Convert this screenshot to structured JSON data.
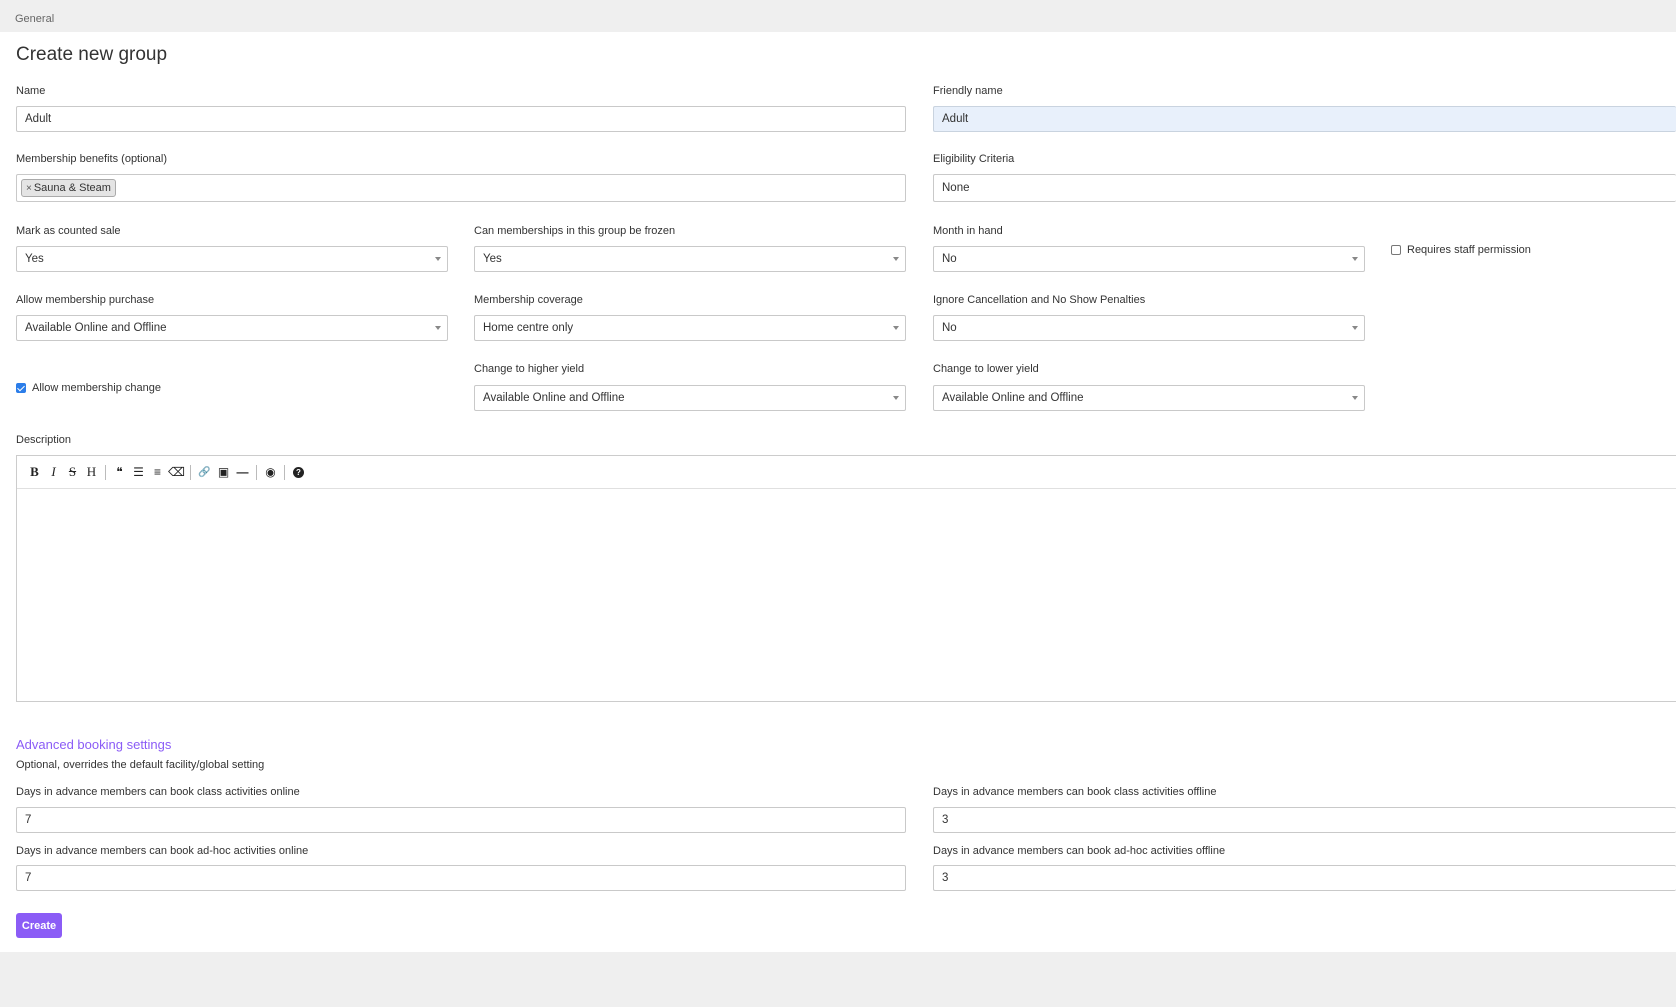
{
  "breadcrumb": "General",
  "page_title": "Create new group",
  "fields": {
    "name": {
      "label": "Name",
      "value": "Adult"
    },
    "friendly_name": {
      "label": "Friendly name",
      "value": "Adult"
    },
    "benefits": {
      "label": "Membership benefits (optional)",
      "tags": [
        "Sauna & Steam"
      ],
      "tag_remove": "×"
    },
    "eligibility": {
      "label": "Eligibility Criteria",
      "value": "None"
    },
    "counted_sale": {
      "label": "Mark as counted sale",
      "value": "Yes"
    },
    "frozen": {
      "label": "Can memberships in this group be frozen",
      "value": "Yes"
    },
    "month_in_hand": {
      "label": "Month in hand",
      "value": "No"
    },
    "staff_permission": {
      "label": "Requires staff permission",
      "checked": false
    },
    "allow_purchase": {
      "label": "Allow membership purchase",
      "value": "Available Online and Offline"
    },
    "coverage": {
      "label": "Membership coverage",
      "value": "Home centre only"
    },
    "ignore_penalties": {
      "label": "Ignore Cancellation and No Show Penalties",
      "value": "No"
    },
    "allow_change": {
      "label": "Allow membership change",
      "checked": true
    },
    "higher_yield": {
      "label": "Change to higher yield",
      "value": "Available Online and Offline"
    },
    "lower_yield": {
      "label": "Change to lower yield",
      "value": "Available Online and Offline"
    },
    "description": {
      "label": "Description",
      "value": ""
    }
  },
  "toolbar": {
    "bold": "B",
    "italic": "I",
    "strike": "S",
    "heading": "H",
    "quote": "❝",
    "ul": "☰",
    "ol": "≡",
    "eraser": "⌫",
    "link": "🔗",
    "image": "▣",
    "hr": "—",
    "preview": "◉",
    "help": "?"
  },
  "advanced": {
    "title": "Advanced booking settings",
    "subtitle": "Optional, overrides the default facility/global setting",
    "class_online": {
      "label": "Days in advance members can book class activities online",
      "value": "7"
    },
    "class_offline": {
      "label": "Days in advance members can book class activities offline",
      "value": "3"
    },
    "adhoc_online": {
      "label": "Days in advance members can book ad-hoc activities online",
      "value": "7"
    },
    "adhoc_offline": {
      "label": "Days in advance members can book ad-hoc activities offline",
      "value": "3"
    }
  },
  "create_label": "Create",
  "colors": {
    "accent": "#8b5cf6",
    "checkbox": "#2b7de9",
    "highlight": "#e8f0fb"
  }
}
